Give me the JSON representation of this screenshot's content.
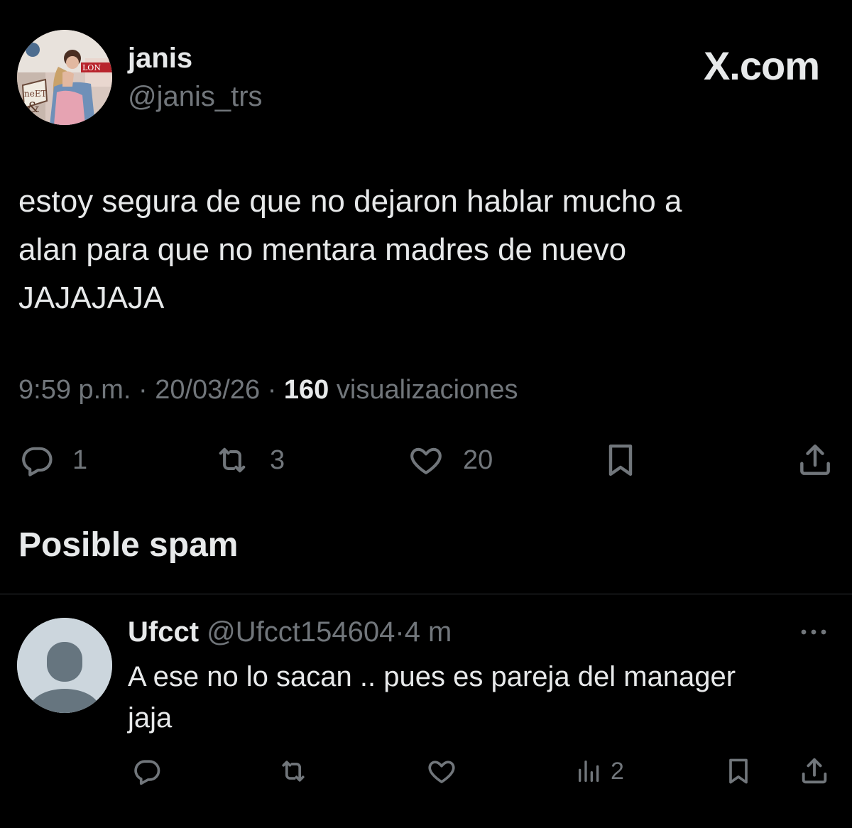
{
  "brand": "X.com",
  "post": {
    "author_name": "janis",
    "author_handle": "@janis_trs",
    "text": "estoy segura de que no dejaron hablar mucho a\nalan para que no mentara madres de nuevo\nJAJAJAJA",
    "time": "9:59 p.m.",
    "date": "20/03/26",
    "views_count": "160",
    "views_label": "visualizaciones",
    "separator": "·",
    "actions": {
      "reply_icon": "reply-icon",
      "reply_count": "1",
      "repost_icon": "repost-icon",
      "repost_count": "3",
      "like_icon": "heart-icon",
      "like_count": "20",
      "bookmark_icon": "bookmark-icon",
      "share_icon": "share-icon"
    }
  },
  "spam_section": {
    "heading": "Posible spam"
  },
  "reply": {
    "author_name": "Ufcct",
    "author_handle": "@Ufcct154604",
    "separator": "·",
    "time_ago": "4 m",
    "text": "A ese no lo sacan .. pues es pareja del manager\njaja",
    "actions": {
      "reply_icon": "reply-icon",
      "repost_icon": "repost-icon",
      "like_icon": "heart-icon",
      "views_icon": "analytics-icon",
      "views_count": "2",
      "bookmark_icon": "bookmark-icon",
      "share_icon": "share-icon"
    }
  },
  "colors": {
    "background": "#000000",
    "primary_text": "#e7e9ea",
    "secondary_text": "#71767b",
    "divider": "#2f3336",
    "default_avatar_bg": "#ccd6dd",
    "default_avatar_fg": "#66757f"
  }
}
